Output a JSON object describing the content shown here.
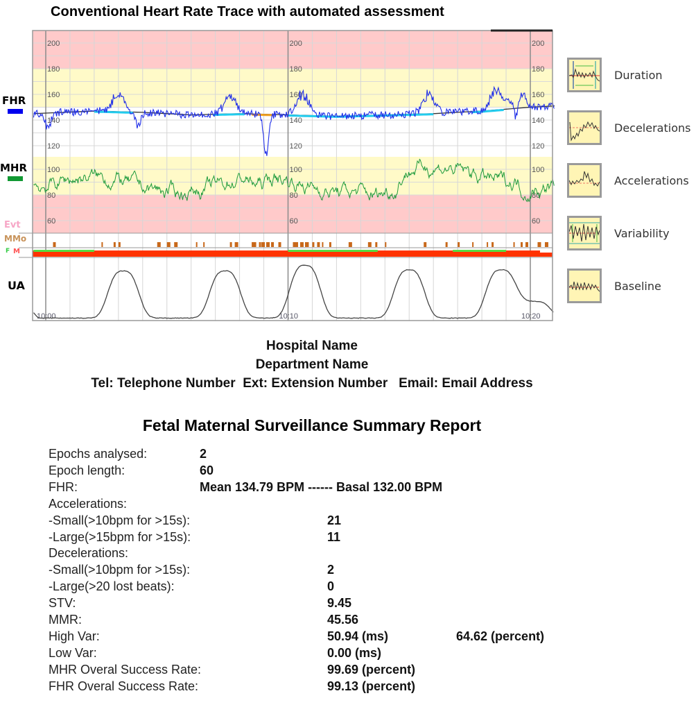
{
  "chart_data": {
    "type": "line",
    "title": "Conventional Heart Rate Trace with automated assessment",
    "time_labels": [
      "10:00",
      "10:10",
      "10:20"
    ],
    "time_range_minutes": [
      -0.5,
      21.0
    ],
    "channels": [
      {
        "name": "FHR",
        "color": "#0000ff",
        "unit": "bpm",
        "ticks": [
          200,
          180,
          160,
          140,
          120
        ],
        "zones": {
          "red_above": 180,
          "yellow_between": [
            150,
            180
          ]
        }
      },
      {
        "name": "MHR",
        "color": "#1a9a3a",
        "unit": "bpm",
        "ticks": [
          100,
          80,
          60
        ],
        "zones": {
          "yellow_between": [
            80,
            110
          ],
          "red_below": 80
        }
      },
      {
        "name": "Evt",
        "color": "#f5a6c8"
      },
      {
        "name": "MMo",
        "color": "#c8681a"
      },
      {
        "name": "F M",
        "color": "#ff3300"
      },
      {
        "name": "UA",
        "color": "#444444"
      }
    ],
    "fhr_baseline": {
      "t": [
        -0.5,
        2,
        4,
        6,
        8,
        10,
        12,
        14,
        16,
        18,
        20,
        21
      ],
      "bpm": [
        145,
        147,
        146,
        144,
        145,
        144,
        143,
        144,
        145,
        147,
        150,
        151
      ]
    },
    "fhr_baseline_segments": [
      {
        "t0": 2.0,
        "t1": 3.6,
        "state": "cyan"
      },
      {
        "t0": 6.9,
        "t1": 8.2,
        "state": "cyan"
      },
      {
        "t0": 8.5,
        "t1": 9.4,
        "state": "orange"
      },
      {
        "t0": 10.0,
        "t1": 16.0,
        "state": "cyan"
      },
      {
        "t0": 17.6,
        "t1": 18.9,
        "state": "cyan"
      }
    ],
    "fhr_events": [
      {
        "t": 3.0,
        "peak": 162
      },
      {
        "t": 7.6,
        "peak": 160
      },
      {
        "t": 10.6,
        "peak": 163
      },
      {
        "t": 15.8,
        "peak": 162
      },
      {
        "t": 18.6,
        "peak": 166
      },
      {
        "t": 19.5,
        "peak": 166
      }
    ],
    "fhr_dips": [
      {
        "t": 0.1,
        "low": 133
      },
      {
        "t": 3.8,
        "low": 136
      },
      {
        "t": 9.1,
        "low": 113
      },
      {
        "t": 19.4,
        "low": 130
      }
    ],
    "mhr_mean": 88,
    "ua_contractions": [
      {
        "t": 3.2,
        "peak": 0.85
      },
      {
        "t": 7.4,
        "peak": 0.85
      },
      {
        "t": 10.7,
        "peak": 0.95
      },
      {
        "t": 15.0,
        "peak": 0.87
      },
      {
        "t": 18.8,
        "peak": 0.87
      },
      {
        "t": 20.2,
        "peak": 0.3
      }
    ],
    "mmo_marks": [
      0.3,
      2.3,
      2.8,
      3.0,
      4.6,
      5.0,
      5.3,
      6.2,
      6.5,
      7.6,
      7.8,
      8.5,
      8.6,
      8.8,
      8.9,
      9.1,
      9.3,
      9.6,
      10.2,
      10.3,
      10.5,
      10.7,
      10.8,
      11.0,
      11.2,
      11.4,
      11.7,
      12.5,
      13.3,
      13.6,
      14.0,
      15.6,
      16.5,
      17.0,
      17.6,
      18.2,
      18.4,
      19.3,
      19.6,
      19.8,
      20.3,
      20.6
    ],
    "fm_green_segments": [
      [
        -0.5,
        2.0
      ],
      [
        10.0,
        13.7
      ],
      [
        16.8,
        19.0
      ]
    ],
    "fm_white_segments": [
      [
        20.4,
        21.0
      ]
    ]
  },
  "side_labels": {
    "fhr": "FHR",
    "mhr": "MHR",
    "evt": "Evt",
    "mmo": "MMo",
    "f": "F",
    "m": "M",
    "ua": "UA"
  },
  "legend": [
    {
      "icon": "duration-icon",
      "label": "Duration"
    },
    {
      "icon": "decelerations-icon",
      "label": "Decelerations"
    },
    {
      "icon": "accelerations-icon",
      "label": "Accelerations"
    },
    {
      "icon": "variability-icon",
      "label": "Variability"
    },
    {
      "icon": "baseline-icon",
      "label": "Baseline"
    }
  ],
  "header": {
    "hospital": "Hospital Name",
    "department": "Department Name",
    "contact": "Tel: Telephone Number  Ext: Extension Number   Email: Email Address"
  },
  "report": {
    "title": "Fetal Maternal Surveillance Summary Report",
    "rows": [
      {
        "label": "Epochs analysed:",
        "value": "2",
        "col": 1
      },
      {
        "label": "Epoch length:",
        "value": "60",
        "col": 1
      },
      {
        "label": "FHR:",
        "value": "Mean 134.79 BPM ------ Basal 132.00 BPM",
        "col": 1
      },
      {
        "label": "Accelerations:",
        "value": ""
      },
      {
        "label": "-Small(>10bpm for >15s):",
        "value": "21",
        "col": 2
      },
      {
        "label": "-Large(>15bpm for >15s):",
        "value": "11",
        "col": 2
      },
      {
        "label": "Decelerations:",
        "value": ""
      },
      {
        "label": "-Small(>10bpm for >15s):",
        "value": "2",
        "col": 2
      },
      {
        "label": "-Large(>20 lost beats):",
        "value": "0",
        "col": 2
      },
      {
        "label": "STV:",
        "value": "9.45",
        "col": 2
      },
      {
        "label": "MMR:",
        "value": "45.56",
        "col": 2
      },
      {
        "label": "High Var:",
        "value": "50.94 (ms)",
        "value2": "64.62 (percent)",
        "col": 2
      },
      {
        "label": "Low Var:",
        "value": "0.00 (ms)",
        "col": 2
      },
      {
        "label": "MHR Overal Success Rate:",
        "value": "99.69 (percent)",
        "col": 2
      },
      {
        "label": "FHR Overal Success Rate:",
        "value": "99.13 (percent)",
        "col": 2
      }
    ]
  }
}
